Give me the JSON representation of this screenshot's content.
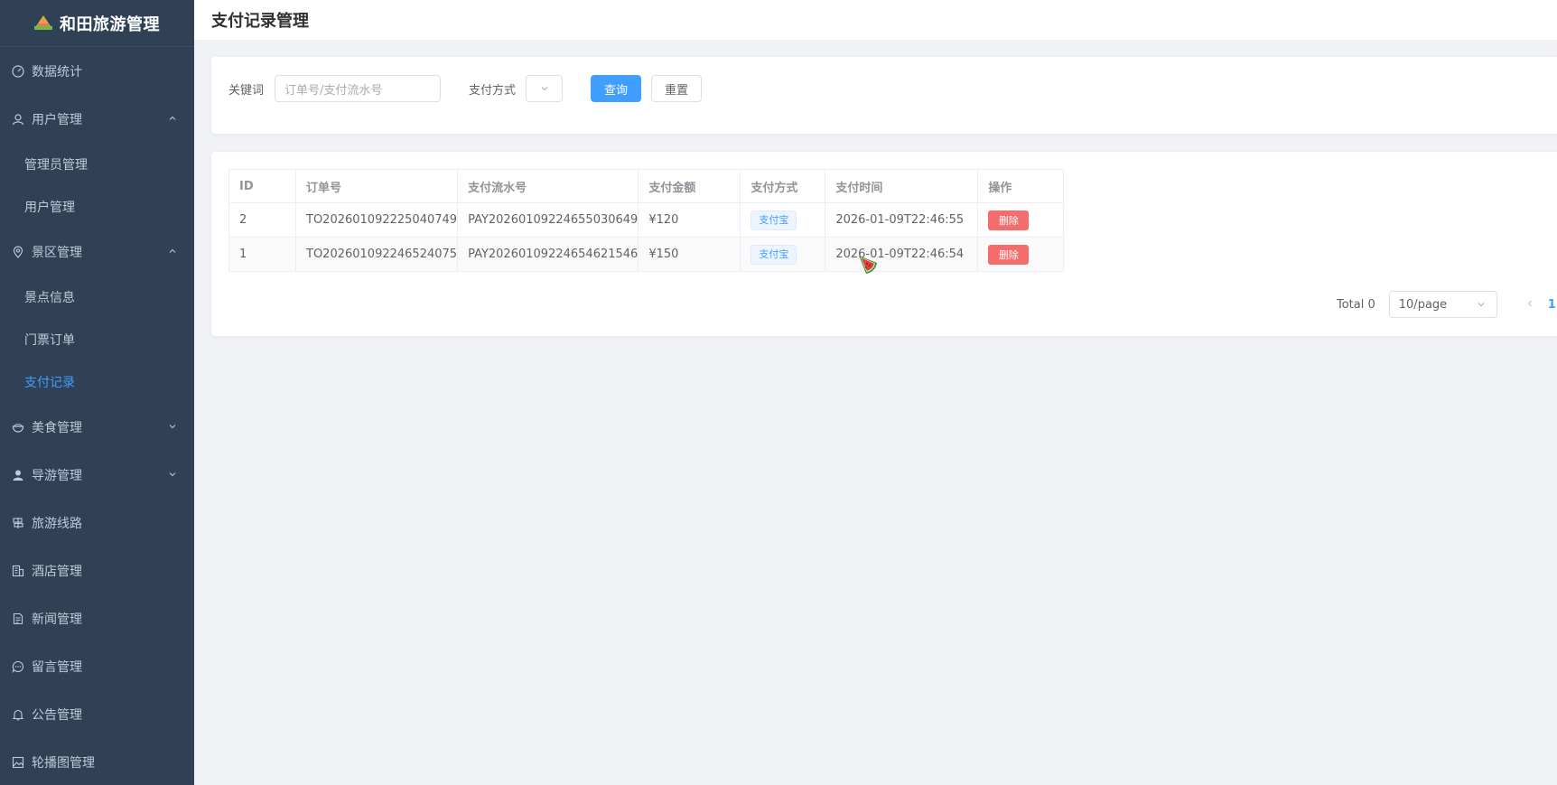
{
  "app": {
    "title": "和田旅游管理"
  },
  "sidebar": {
    "items": [
      {
        "label": "数据统计",
        "icon": "dashboard-icon"
      },
      {
        "label": "用户管理",
        "icon": "user-icon",
        "expanded": true,
        "children": [
          {
            "label": "管理员管理"
          },
          {
            "label": "用户管理"
          }
        ]
      },
      {
        "label": "景区管理",
        "icon": "location-icon",
        "expanded": true,
        "children": [
          {
            "label": "景点信息"
          },
          {
            "label": "门票订单"
          },
          {
            "label": "支付记录",
            "active": true
          }
        ]
      },
      {
        "label": "美食管理",
        "icon": "bowl-icon",
        "expanded": false
      },
      {
        "label": "导游管理",
        "icon": "person-icon",
        "expanded": false
      },
      {
        "label": "旅游线路",
        "icon": "route-icon"
      },
      {
        "label": "酒店管理",
        "icon": "building-icon"
      },
      {
        "label": "新闻管理",
        "icon": "document-icon"
      },
      {
        "label": "留言管理",
        "icon": "chat-icon"
      },
      {
        "label": "公告管理",
        "icon": "bell-icon"
      },
      {
        "label": "轮播图管理",
        "icon": "picture-icon"
      }
    ]
  },
  "header": {
    "title": "支付记录管理"
  },
  "filter": {
    "keyword_label": "关键词",
    "keyword_placeholder": "订单号/支付流水号",
    "method_label": "支付方式",
    "query_label": "查询",
    "reset_label": "重置"
  },
  "table": {
    "columns": [
      "ID",
      "订单号",
      "支付流水号",
      "支付金额",
      "支付方式",
      "支付时间",
      "操作"
    ],
    "rows": [
      {
        "id": "2",
        "order_no": "TO202601092225040749",
        "flow_no": "PAY20260109224655030649",
        "amount": "¥120",
        "method": "支付宝",
        "time": "2026-01-09T22:46:55",
        "action": "删除"
      },
      {
        "id": "1",
        "order_no": "TO202601092246524075",
        "flow_no": "PAY20260109224654621546",
        "amount": "¥150",
        "method": "支付宝",
        "time": "2026-01-09T22:46:54",
        "action": "删除"
      }
    ]
  },
  "pagination": {
    "total_text": "Total 0",
    "page_size": "10/page",
    "current_page": "1"
  },
  "colors": {
    "sidebar_bg": "#304156",
    "primary": "#409eff",
    "danger": "#f56c6c"
  }
}
